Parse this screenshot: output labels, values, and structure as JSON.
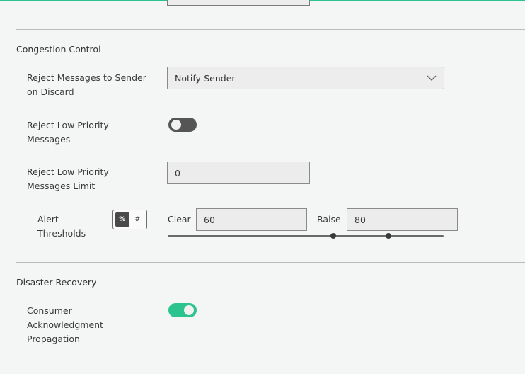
{
  "congestion": {
    "section_title": "Congestion Control",
    "reject_sender": {
      "label": "Reject Messages to Sender on Discard",
      "selected": "Notify-Sender"
    },
    "reject_low_priority": {
      "label": "Reject Low Priority Messages",
      "enabled": false
    },
    "reject_low_priority_limit": {
      "label": "Reject Low Priority Messages Limit",
      "value": "0"
    },
    "alert_thresholds": {
      "label": "Alert Thresholds",
      "unit_percent": "%",
      "unit_count": "#",
      "clear_label": "Clear",
      "clear_value": "60",
      "raise_label": "Raise",
      "raise_value": "80"
    }
  },
  "disaster_recovery": {
    "section_title": "Disaster Recovery",
    "consumer_ack": {
      "label": "Consumer Acknowledgment Propagation",
      "enabled": true
    }
  },
  "colors": {
    "accent": "#2bc48f",
    "toggle_off": "#555555"
  }
}
